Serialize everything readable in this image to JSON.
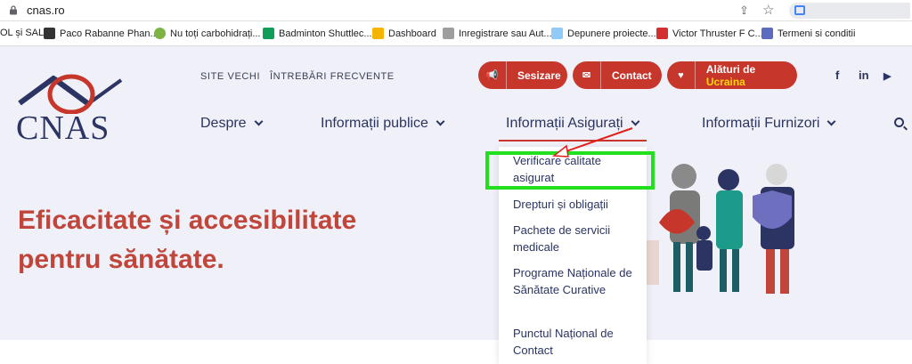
{
  "browser": {
    "url": "cnas.ro",
    "bookmarks": [
      {
        "label": "OL și SAL",
        "color": "#e0e0e0"
      },
      {
        "label": "Paco Rabanne Phan...",
        "color": "#333333"
      },
      {
        "label": "Nu toți carbohidrați...",
        "color": "#7cb342"
      },
      {
        "label": "Badminton Shuttlec...",
        "color": "#0f9d58"
      },
      {
        "label": "Dashboard",
        "color": "#f4b400"
      },
      {
        "label": "Inregistrare sau Aut...",
        "color": "#9e9e9e"
      },
      {
        "label": "Depunere proiecte...",
        "color": "#90caf9"
      },
      {
        "label": "Victor Thruster F C...",
        "color": "#d32f2f"
      },
      {
        "label": "Termeni si conditii",
        "color": "#5c6bc0"
      }
    ]
  },
  "site": {
    "logo_text": "CNAS",
    "top_links": [
      "SITE VECHI",
      "ÎNTREBĂRI FRECVENTE"
    ],
    "pills": [
      {
        "label": "Sesizare",
        "icon": "megaphone-icon"
      },
      {
        "label": "Contact",
        "icon": "envelope-icon"
      },
      {
        "label_pre": "Alături de ",
        "label_accent": "Ucraina",
        "icon": "hand-heart-icon"
      }
    ],
    "social": [
      "f",
      "in",
      "▶"
    ],
    "nav": [
      "Despre",
      "Informații publice",
      "Informații Asigurați",
      "Informații Furnizori"
    ],
    "hero_line1": "Eficacitate și accesibilitate",
    "hero_line2": "pentru sănătate.",
    "dropdown": [
      "Verificare calitate asigurat",
      "Drepturi și obligații",
      "Pachete de servicii medicale",
      "Programe Naționale de Sănătate Curative",
      "Punctul Național de Contact"
    ],
    "colors": {
      "accent": "#c7362b",
      "navy": "#2b3462",
      "highlight": "#22e01e"
    }
  }
}
